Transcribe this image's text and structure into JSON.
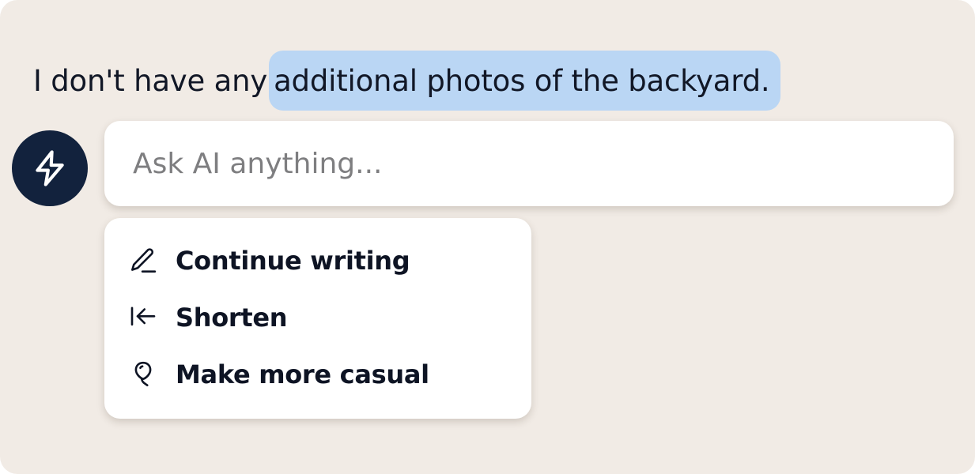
{
  "document": {
    "text_plain": "I don't have any",
    "text_selected": "additional photos of the backyard."
  },
  "ai_prompt": {
    "badge_icon": "lightning-bolt-icon",
    "placeholder": "Ask AI anything...",
    "value": ""
  },
  "suggestions": [
    {
      "icon": "pencil-icon",
      "label": "Continue writing"
    },
    {
      "icon": "arrow-left-to-bar-icon",
      "label": "Shorten"
    },
    {
      "icon": "balloon-icon",
      "label": "Make more casual"
    }
  ],
  "colors": {
    "background": "#f1ebe5",
    "selection": "#bad6f4",
    "badge": "#12223d",
    "text": "#111726",
    "placeholder": "#7e7e80"
  }
}
